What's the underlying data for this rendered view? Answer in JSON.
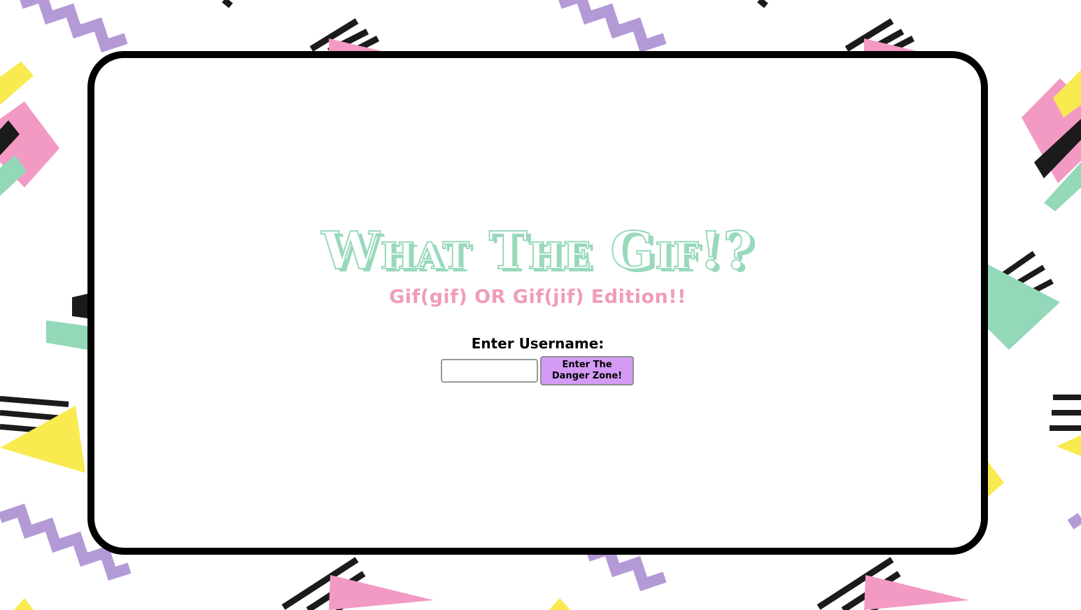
{
  "page": {
    "title": "What The Gif!?",
    "subtitle": "Gif(gif) OR Gif(jif) Edition!!"
  },
  "form": {
    "username_label": "Enter Username:",
    "username_value": "",
    "submit_label": "Enter The Danger Zone!"
  },
  "colors": {
    "title_outline": "#98d9bb",
    "subtitle": "#f09cbb",
    "button": "#d49bf5",
    "card_border": "#000000",
    "pattern_pink": "#f29ac4",
    "pattern_yellow": "#f8ea4f",
    "pattern_mint": "#93d8b9",
    "pattern_purple": "#b39ad6",
    "pattern_black": "#1b1b1b"
  }
}
